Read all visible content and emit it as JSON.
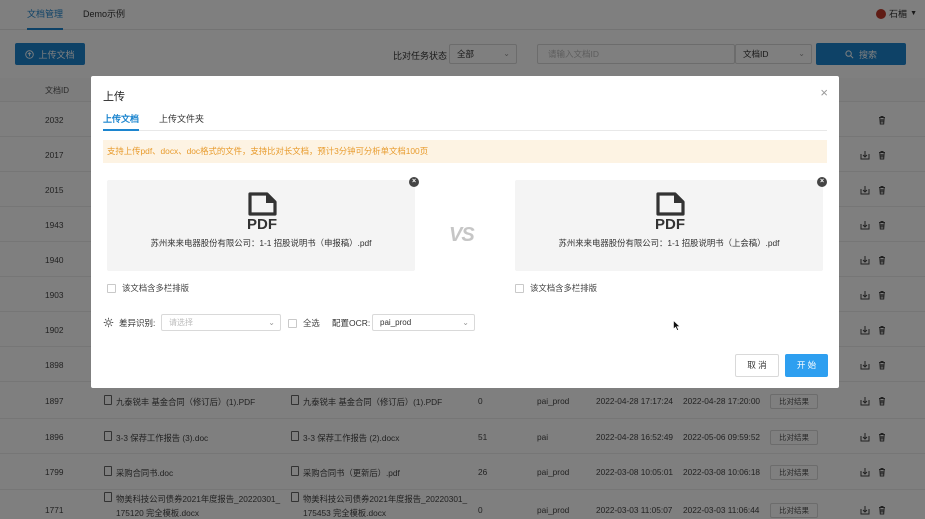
{
  "topnav": {
    "docs": "文档管理",
    "demo": "Demo示例",
    "user": "石楣"
  },
  "toolbar": {
    "upload": "上传文档",
    "status_label": "比对任务状态",
    "status_value": "全部",
    "search_placeholder": "请输入文档ID",
    "field_value": "文档ID",
    "search": "搜索"
  },
  "table": {
    "col_id": "文档ID",
    "rows": [
      {
        "id": "2032"
      },
      {
        "id": "2017"
      },
      {
        "id": "2015"
      },
      {
        "id": "1943"
      },
      {
        "id": "1940"
      },
      {
        "id": "1903"
      },
      {
        "id": "1902"
      },
      {
        "id": "1898"
      },
      {
        "id": "1897",
        "left_doc": "九泰锐丰 基金合同（修订后）(1).PDF",
        "right_doc": "九泰锐丰 基金合同（修订后）(1).PDF",
        "diff": "0",
        "ocr": "pai_prod",
        "created": "2022-04-28 17:17:24",
        "finished": "2022-04-28 17:20:00",
        "result": "比对结果"
      },
      {
        "id": "1896",
        "left_doc": "3-3 保荐工作报告 (3).doc",
        "right_doc": "3-3 保荐工作报告 (2).docx",
        "diff": "51",
        "ocr": "pai",
        "created": "2022-04-28 16:52:49",
        "finished": "2022-05-06 09:59:52",
        "result": "比对结果"
      },
      {
        "id": "1799",
        "left_doc": "采购合同书.doc",
        "right_doc": "采购合同书（更新后）.pdf",
        "diff": "26",
        "ocr": "pai_prod",
        "created": "2022-03-08 10:05:01",
        "finished": "2022-03-08 10:06:18",
        "result": "比对结果"
      },
      {
        "id": "1771",
        "left_doc": "物美科技公司债券2021年度报告_20220301_",
        "left_doc2": "175120 完全模板.docx",
        "right_doc": "物美科技公司债券2021年度报告_20220301_",
        "right_doc2": "175453 完全模板.docx",
        "diff": "0",
        "ocr": "pai_prod",
        "created": "2022-03-03 11:05:07",
        "finished": "2022-03-03 11:06:44",
        "result": "比对结果"
      }
    ]
  },
  "modal": {
    "title": "上传",
    "tab_doc": "上传文档",
    "tab_folder": "上传文件夹",
    "notice": "支持上传pdf、docx、doc格式的文件，支持比对长文档，预计3分钟可分析单文档100页",
    "left_file": "苏州来来电器股份有限公司：1-1 招股说明书（申报稿）.pdf",
    "right_file": "苏州来来电器股份有限公司：1-1 招股说明书（上会稿）.pdf",
    "pdf_text": "PDF",
    "vs": "VS",
    "multi_col": "该文档含多栏排版",
    "diff_label": "差异识别:",
    "diff_placeholder": "请选择",
    "select_all": "全选",
    "ocr_label": "配置OCR:",
    "ocr_value": "pai_prod",
    "cancel": "取 消",
    "start": "开 始"
  }
}
